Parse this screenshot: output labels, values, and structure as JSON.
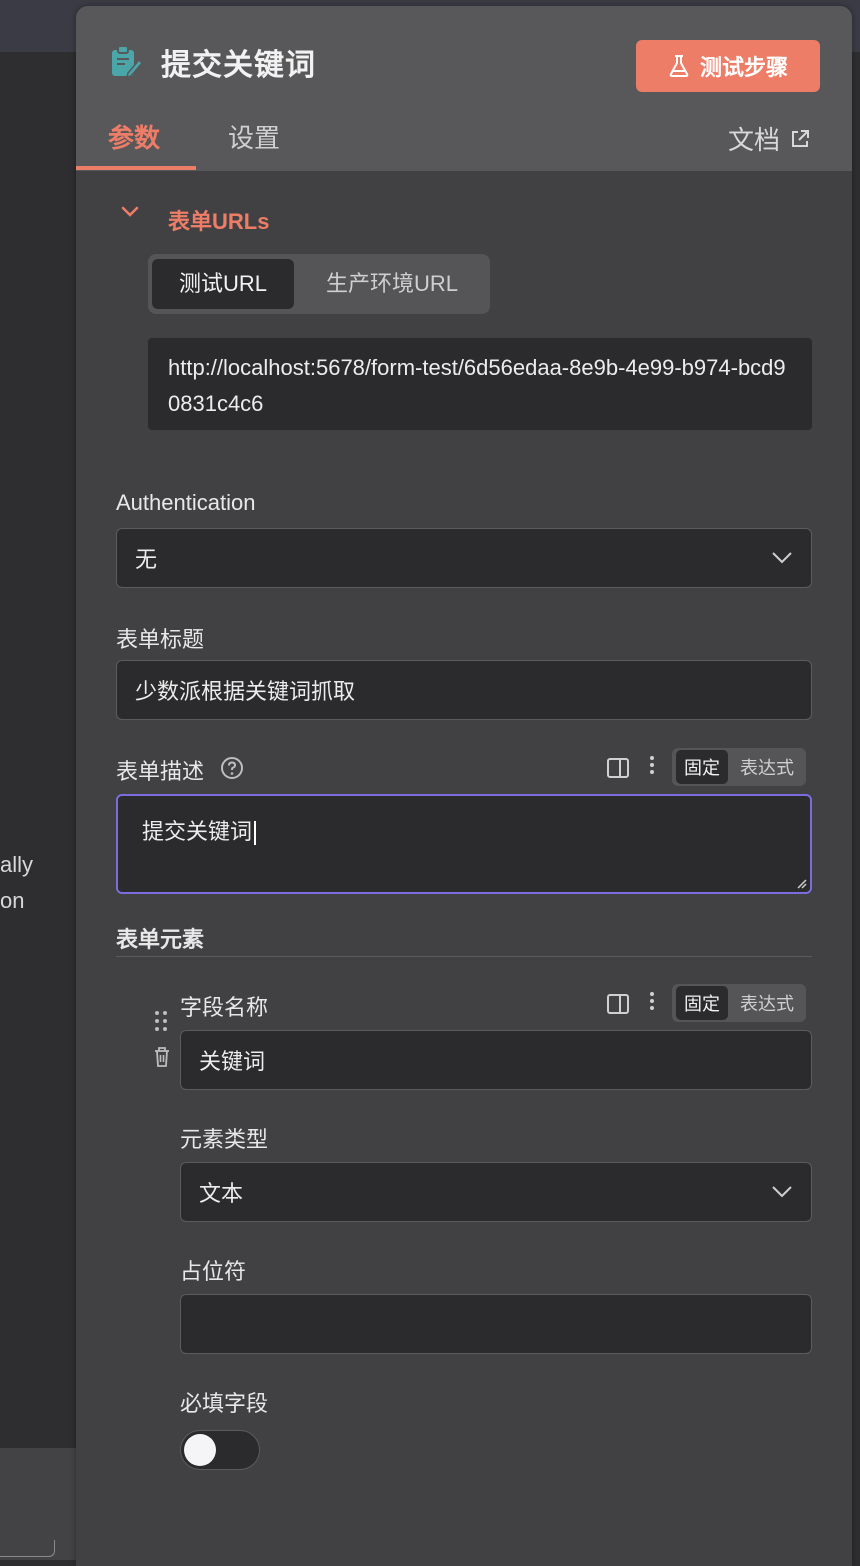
{
  "background": {
    "fragment_1": "ally",
    "fragment_2": "on"
  },
  "node": {
    "title": "提交关键词",
    "icon": "form-edit-icon",
    "test_button_label": "测试步骤",
    "test_button_icon": "flask-icon"
  },
  "tabs": [
    {
      "label": "参数",
      "active": true
    },
    {
      "label": "设置",
      "active": false
    }
  ],
  "docs_link": {
    "label": "文档",
    "icon": "external-link-icon"
  },
  "form_urls": {
    "title": "表单URLs",
    "segments": [
      {
        "label": "测试URL",
        "active": true
      },
      {
        "label": "生产环境URL",
        "active": false
      }
    ],
    "url_value": "http://localhost:5678/form-test/6d56edaa-8e9b-4e99-b974-bcd90831c4c6"
  },
  "authentication": {
    "label": "Authentication",
    "value": "无"
  },
  "form_title": {
    "label": "表单标题",
    "value": "少数派根据关键词抓取"
  },
  "form_description": {
    "label": "表单描述",
    "value": "提交关键词",
    "mode_fixed": "固定",
    "mode_expression": "表达式"
  },
  "form_elements": {
    "label": "表单元素",
    "field_name": {
      "label": "字段名称",
      "value": "关键词",
      "mode_fixed": "固定",
      "mode_expression": "表达式"
    },
    "element_type": {
      "label": "元素类型",
      "value": "文本"
    },
    "placeholder": {
      "label": "占位符",
      "value": ""
    },
    "required": {
      "label": "必填字段",
      "checked": false
    }
  },
  "colors": {
    "accent": "#ee7d68",
    "focus_border": "#7b6ce0",
    "panel_bg": "#414143",
    "input_bg": "#2b2b2d"
  }
}
